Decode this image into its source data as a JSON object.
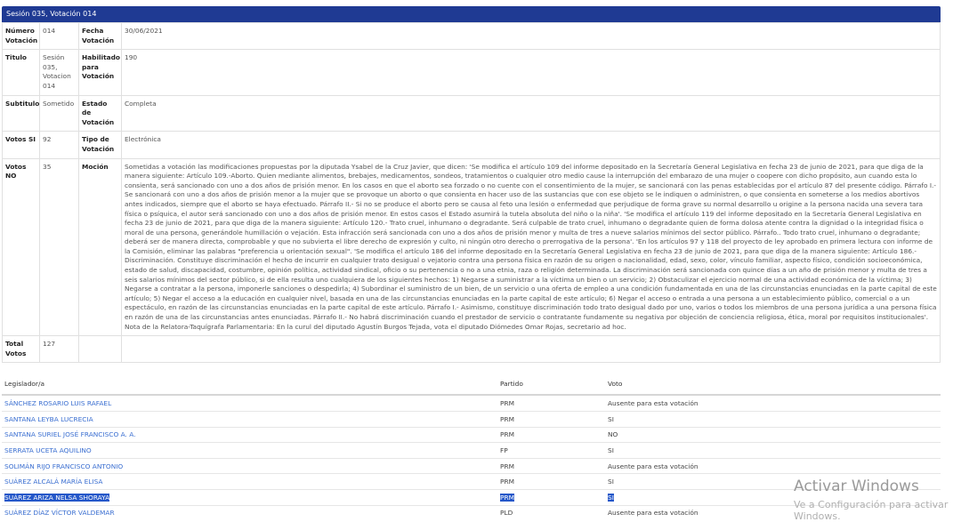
{
  "header": {
    "title": "Sesión 035, Votación 014"
  },
  "detail": {
    "numero_label": "Número Votación",
    "numero": "014",
    "fecha_label": "Fecha Votación",
    "fecha": "30/06/2021",
    "titulo_label": "Titulo",
    "titulo": "Sesión 035, Votacion 014",
    "habilitado_label": "Habilitado para Votación",
    "habilitado": "190",
    "subtitulo_label": "Subtitulo",
    "subtitulo": "Sometido",
    "estado_label": "Estado de Votación",
    "estado": "Completa",
    "si_label": "Votos SI",
    "si": "92",
    "tipo_label": "Tipo de Votación",
    "tipo": "Electrónica",
    "no_label": "Votos NO",
    "no": "35",
    "mocion_label": "Moción",
    "mocion": "Sometidas a votación las modificaciones propuestas por la diputada Ysabel de la Cruz Javier, que dicen: 'Se modifica el artículo 109 del informe depositado en la Secretaría General Legislativa en fecha 23 de junio de 2021, para que diga de la manera siguiente: Artículo 109.-Aborto. Quien mediante alimentos, brebajes, medicamentos, sondeos, tratamientos o cualquier otro medio cause la interrupción del embarazo de una mujer o coopere con dicho propósito, aun cuando esta lo consienta, será sancionado con uno a dos años de prisión menor. En los casos en que el aborto sea forzado o no cuente con el consentimiento de la mujer, se sancionará con las penas establecidas por el artículo 87 del presente código. Párrafo I.- Se sancionará con uno a dos años de prisión menor a la mujer que se provoque un aborto o que consienta en hacer uso de las sustancias que con ese objeto se le indiquen o administren, o que consienta en someterse a los medios abortivos antes indicados, siempre que el aborto se haya efectuado. Párrafo II.- Si no se produce el aborto pero se causa al feto una lesión o enfermedad que perjudique de forma grave su normal desarrollo u origine a la persona nacida una severa tara física o psíquica, el autor será sancionado con uno a dos años de prisión menor. En estos casos el Estado asumirá la tutela absoluta del niño o la niña'. 'Se modifica el artículo 119 del informe depositado en la Secretaría General Legislativa en fecha 23 de junio de 2021, para que diga de la manera siguiente: Artículo 120.- Trato cruel, inhumano o degradante. Será culpable de trato cruel, inhumano o degradante quien de forma dolosa atente contra la dignidad o la integridad física o moral de una persona, generándole humillación o vejación. Esta infracción será sancionada con uno a dos años de prisión menor y multa de tres a nueve salarios mínimos del sector público. Párrafo.. Todo trato cruel, inhumano o degradante; deberá ser de manera directa, comprobable y que no subvierta el libre derecho de expresión y culto, ni ningún otro derecho o prerrogativa de la persona'. 'En los artículos 97 y 118 del proyecto de ley aprobado en primera lectura con informe de la Comisión, eliminar las palabras \"preferencia u orientación sexual\". 'Se modifica el artículo 186 del informe depositado en la Secretaría General Legislativa en fecha 23 de junio de 2021, para que diga de la manera siguiente: Artículo 186.- Discriminación. Constituye discriminación el hecho de incurrir en cualquier trato desigual o vejatorio contra una persona física en razón de su origen o nacionalidad, edad, sexo, color, vínculo familiar, aspecto físico, condición socioeconómica, estado de salud, discapacidad, costumbre, opinión política, actividad sindical, oficio o su pertenencia o no a una etnia, raza o religión determinada. La discriminación será sancionada con quince días a un año de prisión menor y multa de tres a seis salarios mínimos del sector público, si de ella resulta uno cualquiera de los siguientes hechos: 1) Negarse a suministrar a la víctima un bien o un servicio; 2) Obstaculizar el ejercicio normal de una actividad económica de la víctima; 3) Negarse a contratar a la persona, imponerle sanciones o despedirla; 4) Subordinar el suministro de un bien, de un servicio o una oferta de empleo a una condición fundamentada en una de las circunstancias enunciadas en la parte capital de este artículo; 5) Negar el acceso a la educación en cualquier nivel, basada en una de las circunstancias enunciadas en la parte capital de este artículo; 6) Negar el acceso o entrada a una persona a un establecimiento público, comercial o a un espectáculo, en razón de las circunstancias enunciadas en la parte capital de este artículo. Párrafo I.- Asimismo, constituye discriminación todo trato desigual dado por uno, varios o todos los miembros de una persona jurídica a una persona física en razón de una de las circunstancias antes enunciadas. Párrafo II.- No habrá discriminación cuando el prestador de servicio o contratante fundamente su negativa por objeción de conciencia religiosa, ética, moral por requisitos institucionales'. Nota de la Relatora-Taquígrafa Parlamentaria: En la curul del diputado Agustín Burgos Tejada, vota el diputado Diómedes Omar Rojas, secretario ad hoc.",
    "total_label": "Total Votos",
    "total": "127"
  },
  "list": {
    "col_legislador": "Legislador/a",
    "col_partido": "Partido",
    "col_voto": "Voto",
    "rows": [
      {
        "name": "SÁNCHEZ ROSARIO LUIS RAFAEL",
        "partido": "PRM",
        "voto": "Ausente para esta votación"
      },
      {
        "name": "SANTANA LEYBA LUCRECIA",
        "partido": "PRM",
        "voto": "SI"
      },
      {
        "name": "SANTANA SURIEL JOSÉ FRANCISCO A. A.",
        "partido": "PRM",
        "voto": "NO"
      },
      {
        "name": "SERRATA UCETA AQUILINO",
        "partido": "FP",
        "voto": "SI"
      },
      {
        "name": "SOLIMÁN RIJO FRANCISCO ANTONIO",
        "partido": "PRM",
        "voto": "Ausente para esta votación"
      },
      {
        "name": "SUÁREZ ALCALÁ MARÍA ELISA",
        "partido": "PRM",
        "voto": "SI"
      },
      {
        "name": "SUÁREZ ARIZA NELSA SHORAYA",
        "partido": "PRM",
        "voto": "SI"
      },
      {
        "name": "SUÁREZ DÍAZ VÍCTOR VALDEMAR",
        "partido": "PLD",
        "voto": "Ausente para esta votación"
      }
    ]
  },
  "watermark": {
    "line1": "Activar Windows",
    "line2": "Ve a Configuración para activar Windows."
  }
}
